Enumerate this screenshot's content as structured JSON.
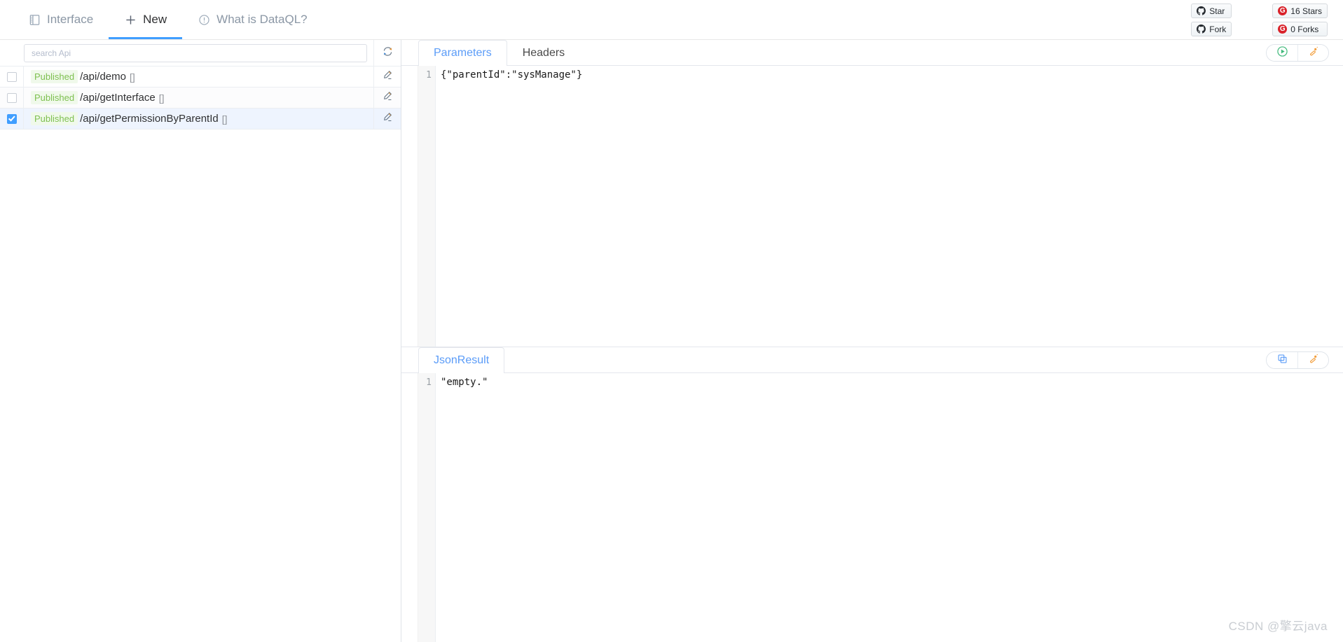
{
  "topnav": {
    "items": [
      {
        "label": "Interface",
        "icon": "book-icon",
        "active": false
      },
      {
        "label": "New",
        "icon": "plus-icon",
        "active": true
      },
      {
        "label": "What is DataQL?",
        "icon": "info-circle-icon",
        "active": false
      }
    ]
  },
  "github": {
    "star_label": "Star",
    "fork_label": "Fork",
    "stars_count": "16 Stars",
    "forks_count": "0 Forks",
    "mark_letter": "G",
    "badge_color": "#d9222a"
  },
  "sidebar": {
    "search": {
      "placeholder": "search Api",
      "value": ""
    },
    "refresh_icon": "refresh-icon",
    "rows": [
      {
        "checked": false,
        "status": "Published",
        "path": "/api/demo",
        "tag": "[]",
        "edit_icon": "pencil-icon"
      },
      {
        "checked": false,
        "status": "Published",
        "path": "/api/getInterface",
        "tag": "[]",
        "edit_icon": "pencil-icon"
      },
      {
        "checked": true,
        "status": "Published",
        "path": "/api/getPermissionByParentId",
        "tag": "[]",
        "edit_icon": "pencil-icon"
      }
    ]
  },
  "params_panel": {
    "tabs": [
      {
        "label": "Parameters",
        "active": true
      },
      {
        "label": "Headers",
        "active": false
      }
    ],
    "actions": [
      {
        "name": "run-button",
        "icon": "play-icon",
        "color": "#3fb97a"
      },
      {
        "name": "format-button",
        "icon": "magic-wand-icon",
        "color": "#f29c38"
      }
    ],
    "line_number": "1",
    "content": "{\"parentId\":\"sysManage\"}"
  },
  "result_panel": {
    "tabs": [
      {
        "label": "JsonResult",
        "active": true
      }
    ],
    "actions": [
      {
        "name": "copy-button",
        "icon": "copy-icon",
        "color": "#5b9cf8"
      },
      {
        "name": "format-button",
        "icon": "magic-wand-icon",
        "color": "#f29c38"
      }
    ],
    "line_number": "1",
    "content": "\"empty.\""
  },
  "watermark": {
    "text": "CSDN @擎云java"
  },
  "colors": {
    "accent": "#409eff",
    "published": "#7ec050",
    "published_bg": "#f0f9eb"
  }
}
